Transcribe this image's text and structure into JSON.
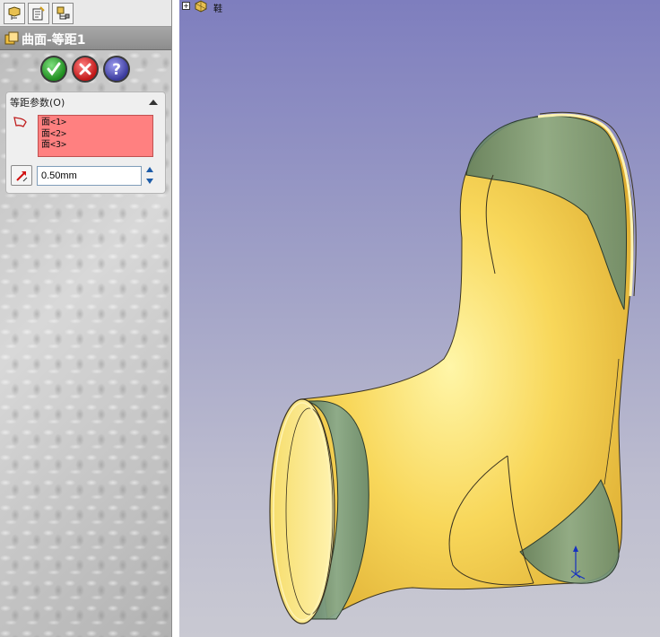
{
  "tabs": [
    {
      "name": "feature-manager",
      "icon": "feature-tree-icon"
    },
    {
      "name": "property-manager",
      "icon": "property-manager-icon"
    },
    {
      "name": "configuration-manager",
      "icon": "configuration-manager-icon"
    }
  ],
  "feature": {
    "title": "曲面-等距1",
    "icon": "offset-surface-icon"
  },
  "actions": {
    "ok": "✓",
    "cancel": "✕",
    "help": "?"
  },
  "parameters": {
    "header": "等距参数(O)",
    "faces": [
      "面<1>",
      "面<2>",
      "面<3>"
    ],
    "offset_value": "0.50mm"
  },
  "viewport": {
    "tree_expander": "+",
    "part_name": "鞋"
  },
  "colors": {
    "face_selection": "#ff8080",
    "model_body": "#f5d24a",
    "offset_surface": "#6f8f6f",
    "viewport_top": "#7e7ebe",
    "viewport_bottom": "#c9c9d2"
  }
}
